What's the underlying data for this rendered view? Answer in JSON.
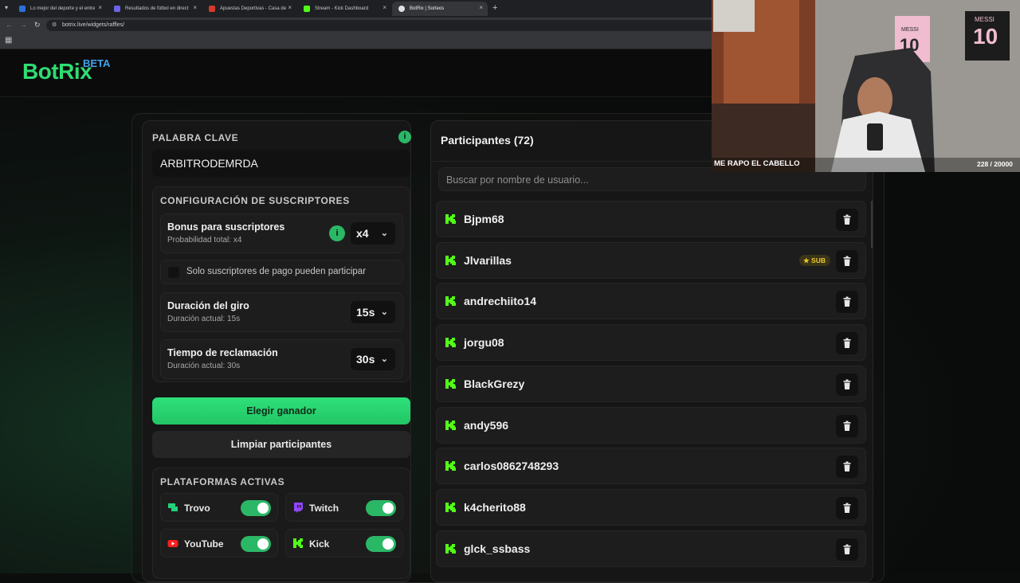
{
  "browser": {
    "tabs": [
      {
        "label": "Lo mejor del deporte y el entre",
        "fav_color": "#2a6fdb"
      },
      {
        "label": "Resultados de fútbol en direct",
        "fav_color": "#6b64e8"
      },
      {
        "label": "Apuestas Deportivas - Casa de",
        "fav_color": "#d33a2c"
      },
      {
        "label": "Stream - Kick Dashboard",
        "fav_color": "#53fc18"
      },
      {
        "label": "BotRix | Sorteos",
        "fav_color": "#e0e0e0"
      }
    ],
    "url": "botrix.live/widgets/raffles/"
  },
  "app": {
    "logo": "BotRix",
    "logo_badge": "BETA"
  },
  "settings": {
    "keyword_label": "PALABRA CLAVE",
    "keyword_value": "ARBITRODEMRDA",
    "subs_section_label": "CONFIGURACIÓN DE SUSCRIPTORES",
    "bonus": {
      "title": "Bonus para suscriptores",
      "subtitle": "Probabilidad total: x4",
      "value": "x4"
    },
    "paid_only_label": "Solo suscriptores de pago pueden participar",
    "spin": {
      "title": "Duración del giro",
      "subtitle": "Duración actual: 15s",
      "value": "15s"
    },
    "claim": {
      "title": "Tiempo de reclamación",
      "subtitle": "Duración actual: 30s",
      "value": "30s"
    },
    "pick_winner_label": "Elegir ganador",
    "clear_label": "Limpiar participantes",
    "platforms_label": "PLATAFORMAS ACTIVAS",
    "platforms": [
      {
        "name": "Trovo",
        "enabled": true
      },
      {
        "name": "Twitch",
        "enabled": true
      },
      {
        "name": "YouTube",
        "enabled": true
      },
      {
        "name": "Kick",
        "enabled": true
      }
    ]
  },
  "participants": {
    "title": "Participantes (72)",
    "search_placeholder": "Buscar por nombre de usuario...",
    "sub_badge": "SUB",
    "rows": [
      {
        "name": "Bjpm68",
        "sub": false
      },
      {
        "name": "Jlvarillas",
        "sub": true
      },
      {
        "name": "andrechiito14",
        "sub": false
      },
      {
        "name": "jorgu08",
        "sub": false
      },
      {
        "name": "BlackGrezy",
        "sub": false
      },
      {
        "name": "andy596",
        "sub": false
      },
      {
        "name": "carlos0862748293",
        "sub": false
      },
      {
        "name": "k4cherito88",
        "sub": false
      },
      {
        "name": "glck_ssbass",
        "sub": false
      }
    ]
  },
  "overlay": {
    "caption": "ME RAPO EL CABELLO",
    "counter": "228 / 20000",
    "jersey_name": "MESSI",
    "jersey_number": "10"
  },
  "colors": {
    "accent": "#2fdc73",
    "brand_blue": "#3ea4ef",
    "kick_green": "#53fc18"
  }
}
